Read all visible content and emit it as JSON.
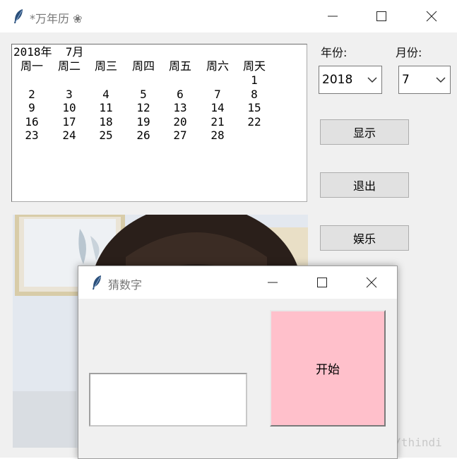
{
  "main_window": {
    "title": "*万年历 ❀",
    "calendar": {
      "header": "2018年  7月",
      "weekdays": [
        "周一",
        "周二",
        "周三",
        "周四",
        "周五",
        "周六",
        "周天"
      ],
      "weeks": [
        [
          "",
          "",
          "",
          "",
          "",
          "",
          "1"
        ],
        [
          "2",
          "3",
          "4",
          "5",
          "6",
          "7",
          "8"
        ],
        [
          "9",
          "10",
          "11",
          "12",
          "13",
          "14",
          "15"
        ],
        [
          "16",
          "17",
          "18",
          "19",
          "20",
          "21",
          "22"
        ],
        [
          "23",
          "24",
          "25",
          "26",
          "27",
          "28",
          ""
        ]
      ]
    },
    "year_label": "年份:",
    "month_label": "月份:",
    "year_value": "2018",
    "month_value": "7",
    "buttons": {
      "show": "显示",
      "quit": "退出",
      "fun": "娱乐"
    }
  },
  "dialog": {
    "title": "猜数字",
    "input_value": "",
    "start_label": "开始"
  },
  "watermark": "https://blog.csdn.net/thindi",
  "icons": [
    "feather-icon",
    "minimize-icon",
    "maximize-icon",
    "close-icon",
    "chevron-down-icon"
  ]
}
